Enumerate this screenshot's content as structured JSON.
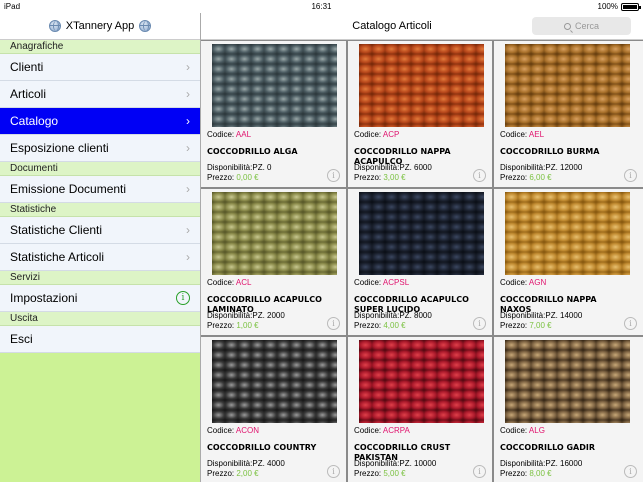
{
  "status": {
    "device": "iPad",
    "time": "16:31",
    "battery": "100%"
  },
  "sidebar": {
    "title": "XTannery App",
    "sections": [
      {
        "label": "Anagrafiche",
        "items": [
          {
            "label": "Clienti",
            "accessory": "chevron"
          },
          {
            "label": "Articoli",
            "accessory": "chevron"
          },
          {
            "label": "Catalogo",
            "accessory": "chevron",
            "active": true
          },
          {
            "label": "Esposizione clienti",
            "accessory": "chevron"
          }
        ]
      },
      {
        "label": "Documenti",
        "items": [
          {
            "label": "Emissione Documenti",
            "accessory": "chevron"
          }
        ]
      },
      {
        "label": "Statistiche",
        "items": [
          {
            "label": "Statistiche Clienti",
            "accessory": "chevron"
          },
          {
            "label": "Statistiche Articoli",
            "accessory": "chevron"
          }
        ]
      },
      {
        "label": "Servizi",
        "items": [
          {
            "label": "Impostazioni",
            "accessory": "info"
          }
        ]
      },
      {
        "label": "Uscita",
        "items": [
          {
            "label": "Esci",
            "accessory": "none"
          }
        ]
      }
    ]
  },
  "main": {
    "title": "Catalogo Articoli",
    "search_placeholder": "Cerca"
  },
  "labels": {
    "code": "Codice:",
    "availability": "Disponibilità:",
    "price": "Prezzo:"
  },
  "articles": [
    {
      "code": "AAL",
      "name": "COCCODRILLO ALGA",
      "availability": "PZ. 0",
      "price": "0,00 €",
      "swatch": [
        "#4a5a60",
        "#9aa8a8",
        "#2e3a3e"
      ]
    },
    {
      "code": "ACP",
      "name": "COCCODRILLO NAPPA ACAPULCO",
      "availability": "PZ. 6000",
      "price": "3,00 €",
      "swatch": [
        "#b6461a",
        "#e27a3a",
        "#7a2a0a"
      ]
    },
    {
      "code": "AEL",
      "name": "COCCODRILLO BURMA",
      "availability": "PZ. 12000",
      "price": "6,00 €",
      "swatch": [
        "#a8702a",
        "#d8a060",
        "#6a4010"
      ]
    },
    {
      "code": "ACL",
      "name": "COCCODRILLO ACAPULCO LAMINATO",
      "availability": "PZ. 2000",
      "price": "1,00 €",
      "swatch": [
        "#8a8a4a",
        "#c8c890",
        "#5a5a2a"
      ]
    },
    {
      "code": "ACPSL",
      "name": "COCCODRILLO ACAPULCO SUPER LUCIDO",
      "availability": "PZ. 8000",
      "price": "4,00 €",
      "swatch": [
        "#1c2230",
        "#3a4660",
        "#0c1018"
      ]
    },
    {
      "code": "AGN",
      "name": "COCCODRILLO NAPPA NAXOS",
      "availability": "PZ. 14000",
      "price": "7,00 €",
      "swatch": [
        "#c08a30",
        "#e8c070",
        "#8a5a10"
      ]
    },
    {
      "code": "ACON",
      "name": "COCCODRILLO COUNTRY",
      "availability": "PZ. 4000",
      "price": "2,00 €",
      "swatch": [
        "#3a3a3a",
        "#9a9a9a",
        "#1a1a1a"
      ]
    },
    {
      "code": "ACRPA",
      "name": "COCCODRILLO CRUST PAKISTAN",
      "availability": "PZ. 10000",
      "price": "5,00 €",
      "swatch": [
        "#a8182a",
        "#e0404a",
        "#5a0a12"
      ]
    },
    {
      "code": "ALG",
      "name": "COCCODRILLO GADIR",
      "availability": "PZ. 16000",
      "price": "8,00 €",
      "swatch": [
        "#7a6040",
        "#c8a878",
        "#3a2a18"
      ]
    }
  ]
}
